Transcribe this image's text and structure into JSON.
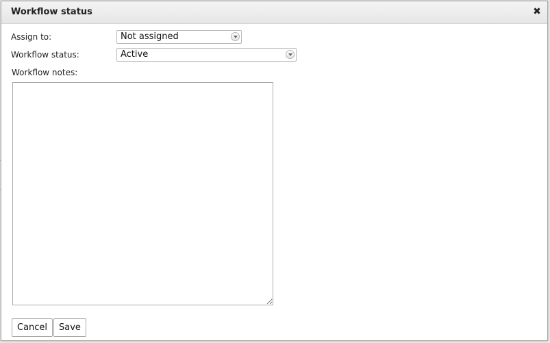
{
  "dialog": {
    "title": "Workflow status",
    "close_icon": "close-icon",
    "close_glyph": "✖"
  },
  "form": {
    "assign_label": "Assign to:",
    "assign_value": "Not assigned",
    "status_label": "Workflow status:",
    "status_value": "Active",
    "notes_label": "Workflow notes:",
    "notes_value": ""
  },
  "buttons": {
    "cancel_label": "Cancel",
    "save_label": "Save"
  }
}
